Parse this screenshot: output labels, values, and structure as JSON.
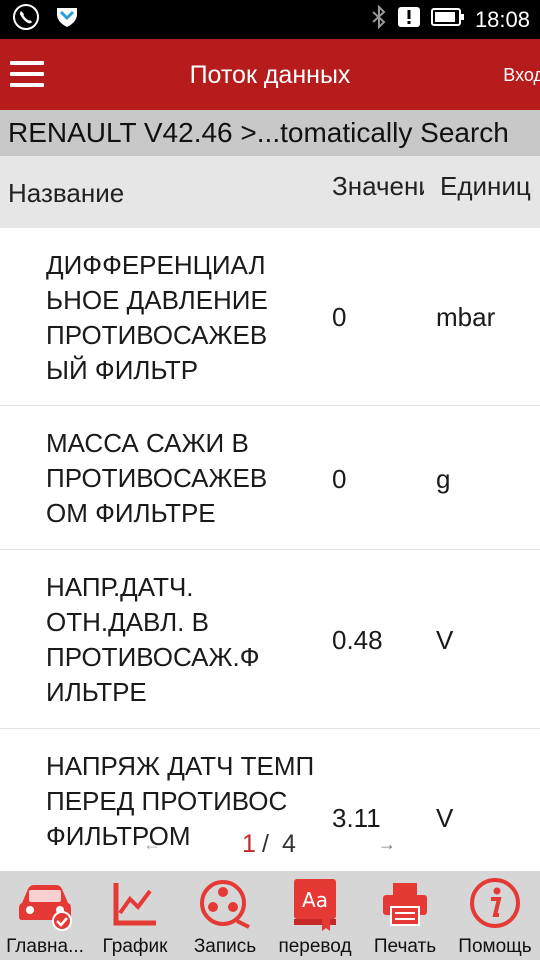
{
  "status_bar": {
    "time": "18:08"
  },
  "app_bar": {
    "title": "Поток данных",
    "enter_label": "Вход"
  },
  "breadcrumb": "RENAULT V42.46 >...tomatically Search",
  "table": {
    "headers": {
      "name": "Название",
      "value": "Значение",
      "unit": "Единица"
    },
    "rows": [
      {
        "name": "ДИФФЕРЕНЦИАЛ ЬНОЕ ДАВЛЕНИЕ ПРОТИВОСАЖЕВ ЫЙ ФИЛЬТР",
        "value": "0",
        "unit": "mbar"
      },
      {
        "name": "МАССА САЖИ В ПРОТИВОСАЖЕВ ОМ ФИЛЬТРЕ",
        "value": "0",
        "unit": "g"
      },
      {
        "name": "НАПР.ДАТЧ. ОТН.ДАВЛ. В ПРОТИВОСАЖ.Ф ИЛЬТРЕ",
        "value": "0.48",
        "unit": "V"
      },
      {
        "name": "НАПРЯЖ ДАТЧ ТЕМП ПЕРЕД ПРОТИВОС ФИЛЬТРОМ",
        "value": "3.11",
        "unit": "V"
      }
    ]
  },
  "pager": {
    "current": "1",
    "separator": "/",
    "total": "4"
  },
  "toolbar": {
    "items": [
      {
        "label": "Главна...",
        "icon": "car-check-icon"
      },
      {
        "label": "График",
        "icon": "chart-icon"
      },
      {
        "label": "Запись",
        "icon": "record-reel-icon"
      },
      {
        "label": "перевод",
        "icon": "translate-icon"
      },
      {
        "label": "Печать",
        "icon": "printer-icon"
      },
      {
        "label": "Помощь",
        "icon": "info-icon"
      }
    ]
  },
  "colors": {
    "accent": "#b71c1c",
    "icon_red": "#e53935"
  }
}
